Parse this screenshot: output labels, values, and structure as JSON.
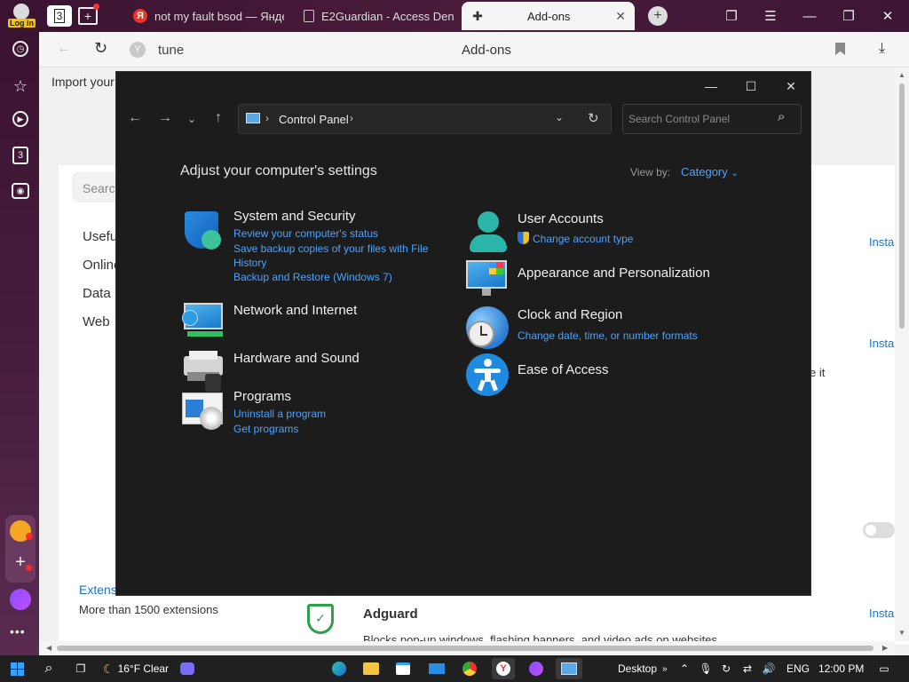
{
  "browser": {
    "login_label": "Log in",
    "tab_count_badge": "3",
    "tabs": [
      {
        "title": "not my fault bsod — Янде"
      },
      {
        "title": "E2Guardian - Access Deni"
      },
      {
        "title": "Add-ons"
      }
    ],
    "address_text": "tune",
    "page_title": "Add-ons",
    "sidebar_badge": "3"
  },
  "background_page": {
    "import_label": "Import your",
    "search_placeholder": "Searc",
    "menu": [
      "Useful",
      "Online",
      "Data",
      "Web"
    ],
    "install_links": [
      "Insta",
      "Insta",
      "Insta"
    ],
    "trailing_text": "e it",
    "extensions_link": "Extens",
    "extensions_count": "More than 1500 extensions",
    "adguard_title": "Adguard",
    "adguard_desc": "Blocks pop-up windows, flashing banners, and video ads on websites"
  },
  "control_panel": {
    "breadcrumb": "Control Panel",
    "search_placeholder": "Search Control Panel",
    "heading": "Adjust your computer's settings",
    "view_by_label": "View by:",
    "view_by_value": "Category",
    "left_categories": [
      {
        "title": "System and Security",
        "links": [
          "Review your computer's status",
          "Save backup copies of your files with File History",
          "Backup and Restore (Windows 7)"
        ]
      },
      {
        "title": "Network and Internet",
        "links": []
      },
      {
        "title": "Hardware and Sound",
        "links": []
      },
      {
        "title": "Programs",
        "links": [
          "Uninstall a program",
          "Get programs"
        ]
      }
    ],
    "right_categories": [
      {
        "title": "User Accounts",
        "links": [
          "Change account type"
        ]
      },
      {
        "title": "Appearance and Personalization",
        "links": []
      },
      {
        "title": "Clock and Region",
        "links": [
          "Change date, time, or number formats"
        ]
      },
      {
        "title": "Ease of Access",
        "links": []
      }
    ]
  },
  "taskbar": {
    "weather": "16°F Clear",
    "desktop_label": "Desktop",
    "language": "ENG",
    "time": "12:00 PM"
  },
  "colors": {
    "link_blue": "#4aa3ff",
    "cp_background": "#1c1c1c",
    "browser_chrome": "#3a1330"
  }
}
